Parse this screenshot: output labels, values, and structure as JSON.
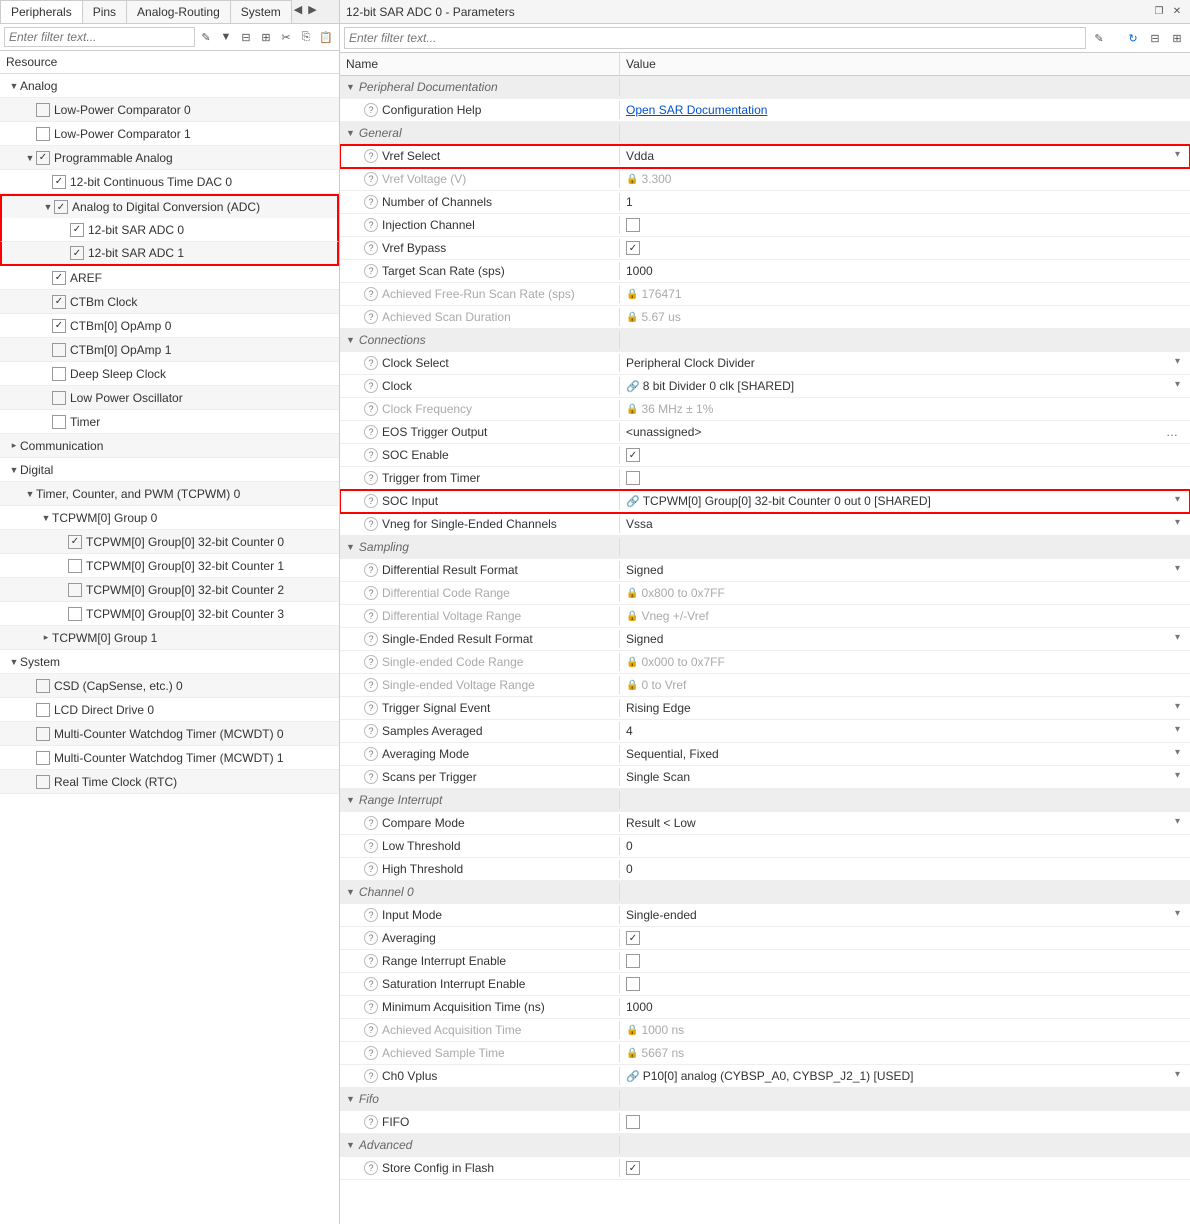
{
  "left": {
    "tabs": [
      "Peripherals",
      "Pins",
      "Analog-Routing",
      "System"
    ],
    "filter_placeholder": "Enter filter text...",
    "resource_header": "Resource",
    "tree": [
      {
        "lvl": 1,
        "arrow": "▼",
        "chk": null,
        "label": "Analog"
      },
      {
        "lvl": 2,
        "arrow": "",
        "chk": false,
        "label": "Low-Power Comparator 0",
        "stripe": true
      },
      {
        "lvl": 2,
        "arrow": "",
        "chk": false,
        "label": "Low-Power Comparator 1"
      },
      {
        "lvl": 2,
        "arrow": "▼",
        "chk": true,
        "label": "Programmable Analog",
        "stripe": true
      },
      {
        "lvl": 3,
        "arrow": "",
        "chk": true,
        "label": "12-bit Continuous Time DAC 0"
      },
      {
        "lvl": 3,
        "arrow": "▼",
        "chk": true,
        "label": "Analog to Digital Conversion (ADC)",
        "stripe": true,
        "hl": "top"
      },
      {
        "lvl": 4,
        "arrow": "",
        "chk": true,
        "label": "12-bit SAR ADC 0",
        "hl": "mid"
      },
      {
        "lvl": 4,
        "arrow": "",
        "chk": true,
        "label": "12-bit SAR ADC 1",
        "stripe": true,
        "hl": "bot"
      },
      {
        "lvl": 3,
        "arrow": "",
        "chk": true,
        "label": "AREF"
      },
      {
        "lvl": 3,
        "arrow": "",
        "chk": true,
        "label": "CTBm Clock",
        "stripe": true
      },
      {
        "lvl": 3,
        "arrow": "",
        "chk": true,
        "label": "CTBm[0] OpAmp 0"
      },
      {
        "lvl": 3,
        "arrow": "",
        "chk": false,
        "label": "CTBm[0] OpAmp 1",
        "stripe": true
      },
      {
        "lvl": 3,
        "arrow": "",
        "chk": false,
        "label": "Deep Sleep Clock"
      },
      {
        "lvl": 3,
        "arrow": "",
        "chk": false,
        "label": "Low Power Oscillator",
        "stripe": true
      },
      {
        "lvl": 3,
        "arrow": "",
        "chk": false,
        "label": "Timer"
      },
      {
        "lvl": 1,
        "arrow": "▸",
        "chk": null,
        "label": "Communication",
        "stripe": true
      },
      {
        "lvl": 1,
        "arrow": "▼",
        "chk": null,
        "label": "Digital"
      },
      {
        "lvl": 2,
        "arrow": "▼",
        "chk": null,
        "label": "Timer, Counter, and PWM (TCPWM) 0",
        "stripe": true
      },
      {
        "lvl": 3,
        "arrow": "▼",
        "chk": null,
        "label": "TCPWM[0] Group 0"
      },
      {
        "lvl": 4,
        "arrow": "",
        "chk": true,
        "label": "TCPWM[0] Group[0] 32-bit Counter 0",
        "stripe": true
      },
      {
        "lvl": 4,
        "arrow": "",
        "chk": false,
        "label": "TCPWM[0] Group[0] 32-bit Counter 1"
      },
      {
        "lvl": 4,
        "arrow": "",
        "chk": false,
        "label": "TCPWM[0] Group[0] 32-bit Counter 2",
        "stripe": true
      },
      {
        "lvl": 4,
        "arrow": "",
        "chk": false,
        "label": "TCPWM[0] Group[0] 32-bit Counter 3"
      },
      {
        "lvl": 3,
        "arrow": "▸",
        "chk": null,
        "label": "TCPWM[0] Group 1",
        "stripe": true
      },
      {
        "lvl": 1,
        "arrow": "▼",
        "chk": null,
        "label": "System"
      },
      {
        "lvl": 2,
        "arrow": "",
        "chk": false,
        "label": "CSD (CapSense, etc.) 0",
        "stripe": true
      },
      {
        "lvl": 2,
        "arrow": "",
        "chk": false,
        "label": "LCD Direct Drive 0"
      },
      {
        "lvl": 2,
        "arrow": "",
        "chk": false,
        "label": "Multi-Counter Watchdog Timer (MCWDT) 0",
        "stripe": true
      },
      {
        "lvl": 2,
        "arrow": "",
        "chk": false,
        "label": "Multi-Counter Watchdog Timer (MCWDT) 1"
      },
      {
        "lvl": 2,
        "arrow": "",
        "chk": false,
        "label": "Real Time Clock (RTC)",
        "stripe": true
      }
    ]
  },
  "right": {
    "title": "12-bit SAR ADC 0 - Parameters",
    "filter_placeholder": "Enter filter text...",
    "name_header": "Name",
    "value_header": "Value",
    "rows": [
      {
        "type": "group",
        "name": "Peripheral Documentation"
      },
      {
        "type": "param",
        "name": "Configuration Help",
        "value": "Open SAR Documentation",
        "link": true
      },
      {
        "type": "group",
        "name": "General"
      },
      {
        "type": "param",
        "name": "Vref Select",
        "value": "Vdda",
        "drop": true,
        "hl": true
      },
      {
        "type": "param",
        "name": "Vref Voltage (V)",
        "value": "3.300",
        "disabled": true,
        "lock": true
      },
      {
        "type": "param",
        "name": "Number of Channels",
        "value": "1"
      },
      {
        "type": "param",
        "name": "Injection Channel",
        "value": "",
        "chk": false
      },
      {
        "type": "param",
        "name": "Vref Bypass",
        "value": "",
        "chk": true
      },
      {
        "type": "param",
        "name": "Target Scan Rate (sps)",
        "value": "1000"
      },
      {
        "type": "param",
        "name": "Achieved Free-Run Scan Rate (sps)",
        "value": "176471",
        "disabled": true,
        "lock": true
      },
      {
        "type": "param",
        "name": "Achieved Scan Duration",
        "value": "5.67 us",
        "disabled": true,
        "lock": true
      },
      {
        "type": "group",
        "name": "Connections"
      },
      {
        "type": "param",
        "name": "Clock Select",
        "value": "Peripheral Clock Divider",
        "drop": true
      },
      {
        "type": "param",
        "name": "Clock",
        "value": "8 bit Divider 0 clk [SHARED]",
        "drop": true,
        "linkico": true
      },
      {
        "type": "param",
        "name": "Clock Frequency",
        "value": "36 MHz ± 1%",
        "disabled": true,
        "lock": true
      },
      {
        "type": "param",
        "name": "EOS Trigger Output",
        "value": "<unassigned>",
        "ellipsis": true
      },
      {
        "type": "param",
        "name": "SOC Enable",
        "value": "",
        "chk": true
      },
      {
        "type": "param",
        "name": "Trigger from Timer",
        "value": "",
        "chk": false
      },
      {
        "type": "param",
        "name": "SOC Input",
        "value": "TCPWM[0] Group[0] 32-bit Counter 0 out 0 [SHARED]",
        "drop": true,
        "linkico": true,
        "hl": true
      },
      {
        "type": "param",
        "name": "Vneg for Single-Ended Channels",
        "value": "Vssa",
        "drop": true
      },
      {
        "type": "group",
        "name": "Sampling"
      },
      {
        "type": "param",
        "name": "Differential Result Format",
        "value": "Signed",
        "drop": true
      },
      {
        "type": "param",
        "name": "Differential Code Range",
        "value": "0x800 to 0x7FF",
        "disabled": true,
        "lock": true
      },
      {
        "type": "param",
        "name": "Differential Voltage Range",
        "value": "Vneg +/-Vref",
        "disabled": true,
        "lock": true
      },
      {
        "type": "param",
        "name": "Single-Ended Result Format",
        "value": "Signed",
        "drop": true
      },
      {
        "type": "param",
        "name": "Single-ended Code Range",
        "value": "0x000 to 0x7FF",
        "disabled": true,
        "lock": true
      },
      {
        "type": "param",
        "name": "Single-ended Voltage Range",
        "value": "0 to Vref",
        "disabled": true,
        "lock": true
      },
      {
        "type": "param",
        "name": "Trigger Signal Event",
        "value": "Rising Edge",
        "drop": true
      },
      {
        "type": "param",
        "name": "Samples Averaged",
        "value": "4",
        "drop": true
      },
      {
        "type": "param",
        "name": "Averaging Mode",
        "value": "Sequential, Fixed",
        "drop": true
      },
      {
        "type": "param",
        "name": "Scans per Trigger",
        "value": "Single Scan",
        "drop": true
      },
      {
        "type": "group",
        "name": "Range Interrupt"
      },
      {
        "type": "param",
        "name": "Compare Mode",
        "value": "Result < Low",
        "drop": true
      },
      {
        "type": "param",
        "name": "Low Threshold",
        "value": "0"
      },
      {
        "type": "param",
        "name": "High Threshold",
        "value": "0"
      },
      {
        "type": "group",
        "name": "Channel 0"
      },
      {
        "type": "param",
        "name": "Input Mode",
        "value": "Single-ended",
        "drop": true
      },
      {
        "type": "param",
        "name": "Averaging",
        "value": "",
        "chk": true
      },
      {
        "type": "param",
        "name": "Range Interrupt Enable",
        "value": "",
        "chk": false
      },
      {
        "type": "param",
        "name": "Saturation Interrupt Enable",
        "value": "",
        "chk": false
      },
      {
        "type": "param",
        "name": "Minimum Acquisition Time (ns)",
        "value": "1000"
      },
      {
        "type": "param",
        "name": "Achieved Acquisition Time",
        "value": "1000 ns",
        "disabled": true,
        "lock": true
      },
      {
        "type": "param",
        "name": "Achieved Sample Time",
        "value": "5667 ns",
        "disabled": true,
        "lock": true
      },
      {
        "type": "param",
        "name": "Ch0 Vplus",
        "value": "P10[0] analog (CYBSP_A0, CYBSP_J2_1) [USED]",
        "drop": true,
        "linkico": true
      },
      {
        "type": "group",
        "name": "Fifo"
      },
      {
        "type": "param",
        "name": "FIFO",
        "value": "",
        "chk": false
      },
      {
        "type": "group",
        "name": "Advanced"
      },
      {
        "type": "param",
        "name": "Store Config in Flash",
        "value": "",
        "chk": true
      }
    ]
  }
}
